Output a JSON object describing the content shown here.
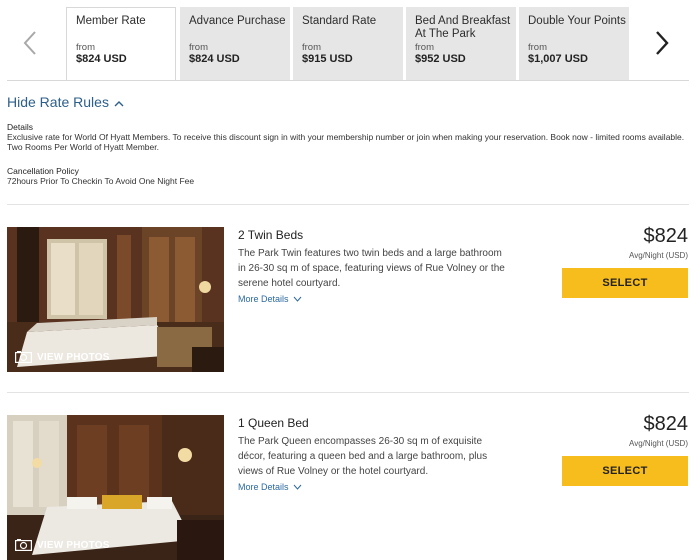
{
  "rate_tabs": [
    {
      "name": "Member Rate",
      "from": "from",
      "price": "$824 USD"
    },
    {
      "name": "Advance Purchase",
      "from": "from",
      "price": "$824 USD"
    },
    {
      "name": "Standard Rate",
      "from": "from",
      "price": "$915 USD"
    },
    {
      "name": "Bed And Breakfast At The Park",
      "from": "from",
      "price": "$952 USD"
    },
    {
      "name": "Double Your Points",
      "from": "from",
      "price": "$1,007 USD"
    }
  ],
  "icons": {
    "prev": "chevron-left-icon",
    "next": "chevron-right-icon",
    "collapse": "chevron-up-icon",
    "expand": "chevron-down-icon",
    "camera": "camera-icon"
  },
  "rate_rules": {
    "toggle_label": "Hide Rate Rules",
    "details_label": "Details",
    "details_text": "Exclusive rate for World Of Hyatt Members. To receive this discount sign in with your membership number or join when making your reservation. Book now - limited rooms available. Two Rooms Per World of Hyatt Member.",
    "cancellation_label": "Cancellation Policy",
    "cancellation_text": "72hours Prior To Checkin To Avoid One Night Fee"
  },
  "rooms": [
    {
      "title": "2 Twin Beds",
      "description": "The Park Twin features two twin beds and a large bathroom in 26-30 sq m of space, featuring views of Rue Volney or the serene hotel courtyard.",
      "more_details": "More Details",
      "price": "$824",
      "price_note": "Avg/Night (USD)",
      "select_label": "SELECT",
      "view_photos": "VIEW PHOTOS"
    },
    {
      "title": "1 Queen Bed",
      "description": "The Park Queen encompasses 26-30 sq m of exquisite décor, featuring a queen bed and a large bathroom, plus views of Rue Volney or the hotel courtyard.",
      "more_details": "More Details",
      "price": "$824",
      "price_note": "Avg/Night (USD)",
      "select_label": "SELECT",
      "view_photos": "VIEW PHOTOS"
    }
  ],
  "colors": {
    "accent_link": "#2c5f8a",
    "select_button": "#f7bd1d",
    "inactive_tab": "#e6e6e6"
  }
}
